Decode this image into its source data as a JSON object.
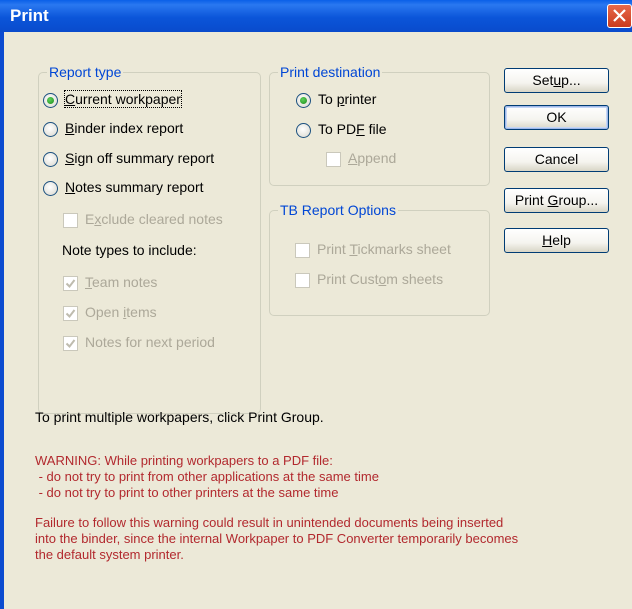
{
  "window": {
    "title": "Print"
  },
  "report_type": {
    "legend": "Report type",
    "options": [
      {
        "label": "Current workpaper",
        "mnemonic": "C",
        "checked": true
      },
      {
        "label": "Binder index report",
        "mnemonic": "B",
        "checked": false
      },
      {
        "label": "Sign off summary report",
        "mnemonic": "S",
        "checked": false
      },
      {
        "label": "Notes summary report",
        "mnemonic": "N",
        "checked": false
      }
    ],
    "exclude_cleared": {
      "label": "Exclude cleared notes",
      "checked": false
    },
    "note_types_label": "Note types to include:",
    "note_types": [
      {
        "label": "Team notes",
        "checked": true
      },
      {
        "label": "Open items",
        "checked": true
      },
      {
        "label": "Notes for next period",
        "checked": true
      }
    ]
  },
  "print_destination": {
    "legend": "Print destination",
    "options": [
      {
        "label": "To printer",
        "checked": true
      },
      {
        "label": "To PDF file",
        "checked": false
      }
    ],
    "append": {
      "label": "Append",
      "checked": false
    }
  },
  "tb_options": {
    "legend": "TB Report Options",
    "items": [
      {
        "label": "Print Tickmarks sheet",
        "checked": false
      },
      {
        "label": "Print Custom sheets",
        "checked": false
      }
    ]
  },
  "buttons": {
    "setup": "Setup...",
    "ok": "OK",
    "cancel": "Cancel",
    "print_group": "Print Group...",
    "help": "Help"
  },
  "info_text": "To print multiple workpapers, click Print Group.",
  "warning": {
    "heading": "WARNING: While printing workpapers to a PDF file:",
    "line1": " - do not try to print from other applications at the same time",
    "line2": " - do not try to print to other printers at the same time",
    "failure1": "Failure to follow this warning could result in unintended documents being inserted",
    "failure2": "into the binder, since the internal Workpaper to PDF Converter temporarily becomes",
    "failure3": "the default system printer."
  },
  "colors": {
    "title_bar": "#0a4bcc",
    "legend": "#0046d5",
    "warning": "#b2292e",
    "dialog_bg": "#ece9d8"
  }
}
